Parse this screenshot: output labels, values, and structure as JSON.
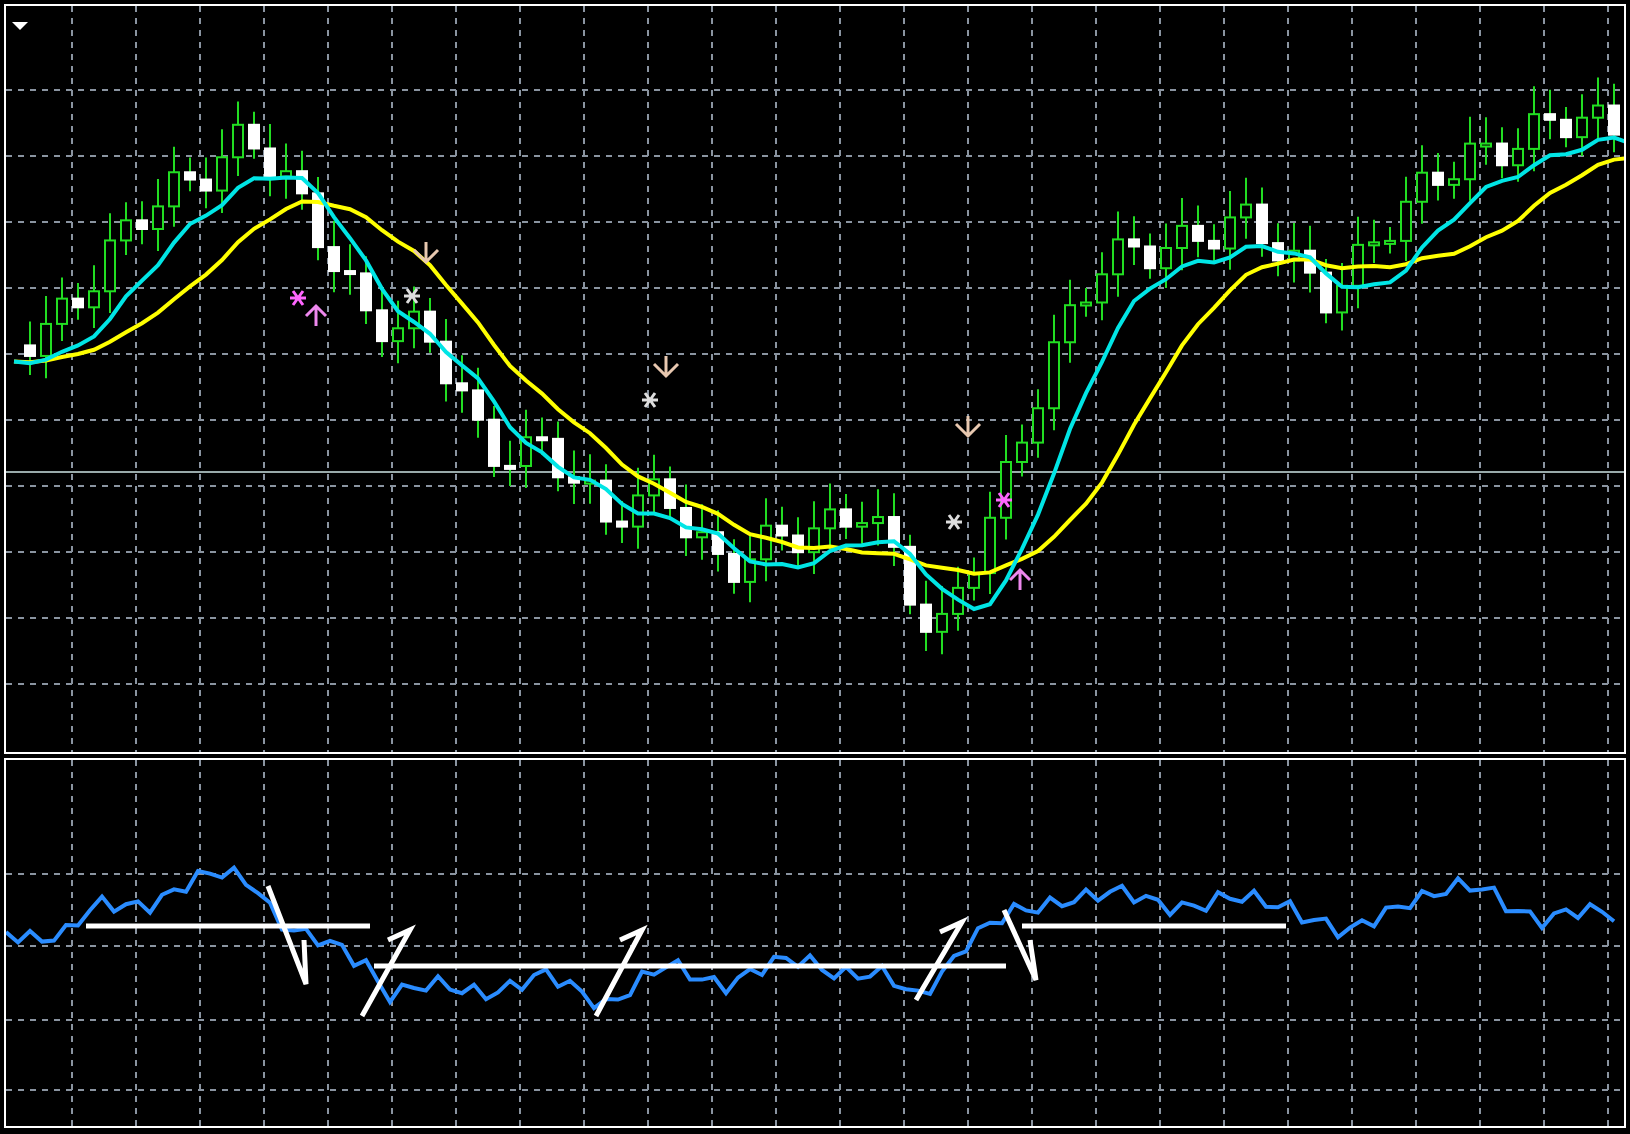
{
  "panels": [
    {
      "kind": "price"
    },
    {
      "kind": "oscillator"
    }
  ]
}
